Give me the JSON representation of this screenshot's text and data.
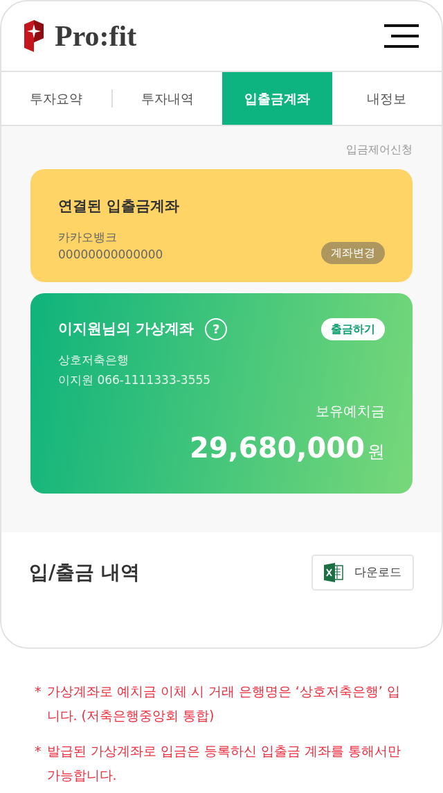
{
  "header": {
    "logo_text": "Pro:fit"
  },
  "tabs": [
    {
      "label": "투자요약",
      "selected": false
    },
    {
      "label": "투자내역",
      "selected": false
    },
    {
      "label": "입출금계좌",
      "selected": true
    },
    {
      "label": "내정보",
      "selected": false
    }
  ],
  "deposit_control_link": "입금제어신청",
  "linked_account": {
    "title": "연결된 입출금계좌",
    "bank": "카카오뱅크",
    "number": "00000000000000",
    "change_button": "계좌변경"
  },
  "virtual_account": {
    "title": "이지원님의 가상계좌",
    "help": "?",
    "withdraw_button": "출금하기",
    "bank": "상호저축은행",
    "holder_number": "이지원 066-1111333-3555",
    "balance_label": "보유예치금",
    "balance": "29,680,000",
    "currency": "원"
  },
  "history": {
    "title": "입/출금 내역",
    "download_button": "다운로드"
  },
  "notes": [
    {
      "marker": "*",
      "text": "가상계좌로 예치금 이체 시 거래 은행명은 ‘상호저축은행’ 입니다. (저축은행중앙회 통합)"
    },
    {
      "marker": "*",
      "text": "발급된 가상계좌로 입금은 등록하신 입출금 계좌를 통해서만 가능합니다."
    }
  ]
}
